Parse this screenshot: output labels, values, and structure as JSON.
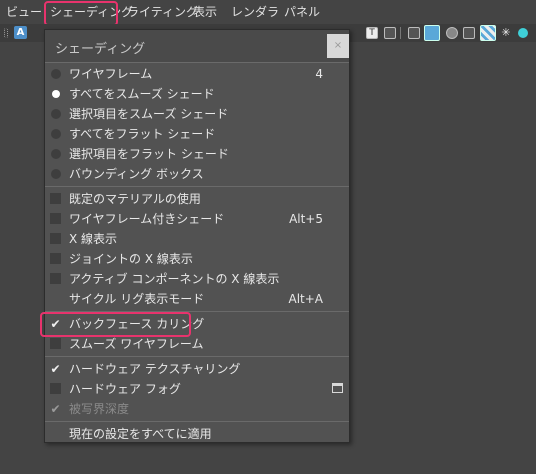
{
  "menubar": {
    "items": [
      "ビュー",
      "シェーディング",
      "ライティング",
      "表示",
      "レンダラ",
      "パネル"
    ]
  },
  "toolbar": {
    "a_label": "A",
    "t_label": "T"
  },
  "menu": {
    "title": "シェーディング",
    "close": "×",
    "radio_items": [
      {
        "label": "ワイヤフレーム",
        "shortcut": "4",
        "selected": false
      },
      {
        "label": "すべてをスムーズ シェード",
        "shortcut": "",
        "selected": true
      },
      {
        "label": "選択項目をスムーズ シェード",
        "shortcut": "",
        "selected": false
      },
      {
        "label": "すべてをフラット シェード",
        "shortcut": "",
        "selected": false
      },
      {
        "label": "選択項目をフラット シェード",
        "shortcut": "",
        "selected": false
      },
      {
        "label": "バウンディング ボックス",
        "shortcut": "",
        "selected": false
      }
    ],
    "check_items_1": [
      {
        "label": "既定のマテリアルの使用",
        "shortcut": "",
        "checked": false
      },
      {
        "label": "ワイヤフレーム付きシェード",
        "shortcut": "Alt+5",
        "checked": false
      },
      {
        "label": "X 線表示",
        "shortcut": "",
        "checked": false
      },
      {
        "label": "ジョイントの X 線表示",
        "shortcut": "",
        "checked": false
      },
      {
        "label": "アクティブ コンポーネントの X 線表示",
        "shortcut": "",
        "checked": false
      },
      {
        "label": "サイクル リグ表示モード",
        "shortcut": "Alt+A",
        "checked": false
      }
    ],
    "check_items_2": [
      {
        "label": "バックフェース カリング",
        "checked": true
      },
      {
        "label": "スムーズ ワイヤフレーム",
        "checked": false
      }
    ],
    "check_items_3": [
      {
        "label": "ハードウェア テクスチャリング",
        "checked": true
      },
      {
        "label": "ハードウェア フォグ",
        "checked": false
      },
      {
        "label": "被写界深度",
        "checked": true,
        "disabled": true
      }
    ],
    "apply_label": "現在の設定をすべてに適用",
    "check_mark": "✔"
  }
}
